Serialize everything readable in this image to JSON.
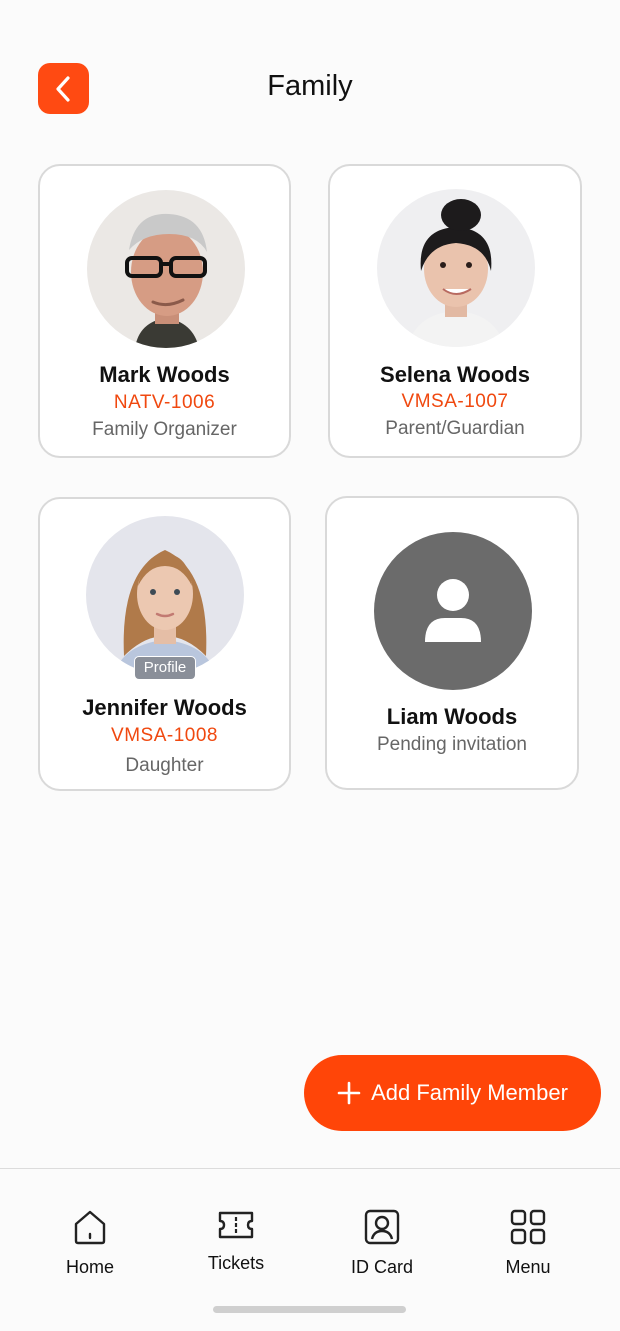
{
  "header": {
    "title": "Family",
    "back_icon": "chevron-left-icon"
  },
  "accent_color": "#ff4a12",
  "members": [
    {
      "name": "Mark Woods",
      "code": "NATV-1006",
      "role": "Family Organizer"
    },
    {
      "name": "Selena Woods",
      "code": "VMSA-1007",
      "role": "Parent/Guardian"
    },
    {
      "name": "Jennifer Woods",
      "code": "VMSA-1008",
      "role": "Daughter",
      "tag": "Profile"
    },
    {
      "name": "Liam Woods",
      "role": "Pending invitation"
    }
  ],
  "add_button": {
    "label": "Add Family Member",
    "icon": "plus-icon"
  },
  "tabbar": {
    "items": [
      {
        "label": "Home",
        "icon": "home-icon"
      },
      {
        "label": "Tickets",
        "icon": "ticket-icon"
      },
      {
        "label": "ID Card",
        "icon": "id-card-icon"
      },
      {
        "label": "Menu",
        "icon": "grid-icon"
      }
    ]
  }
}
